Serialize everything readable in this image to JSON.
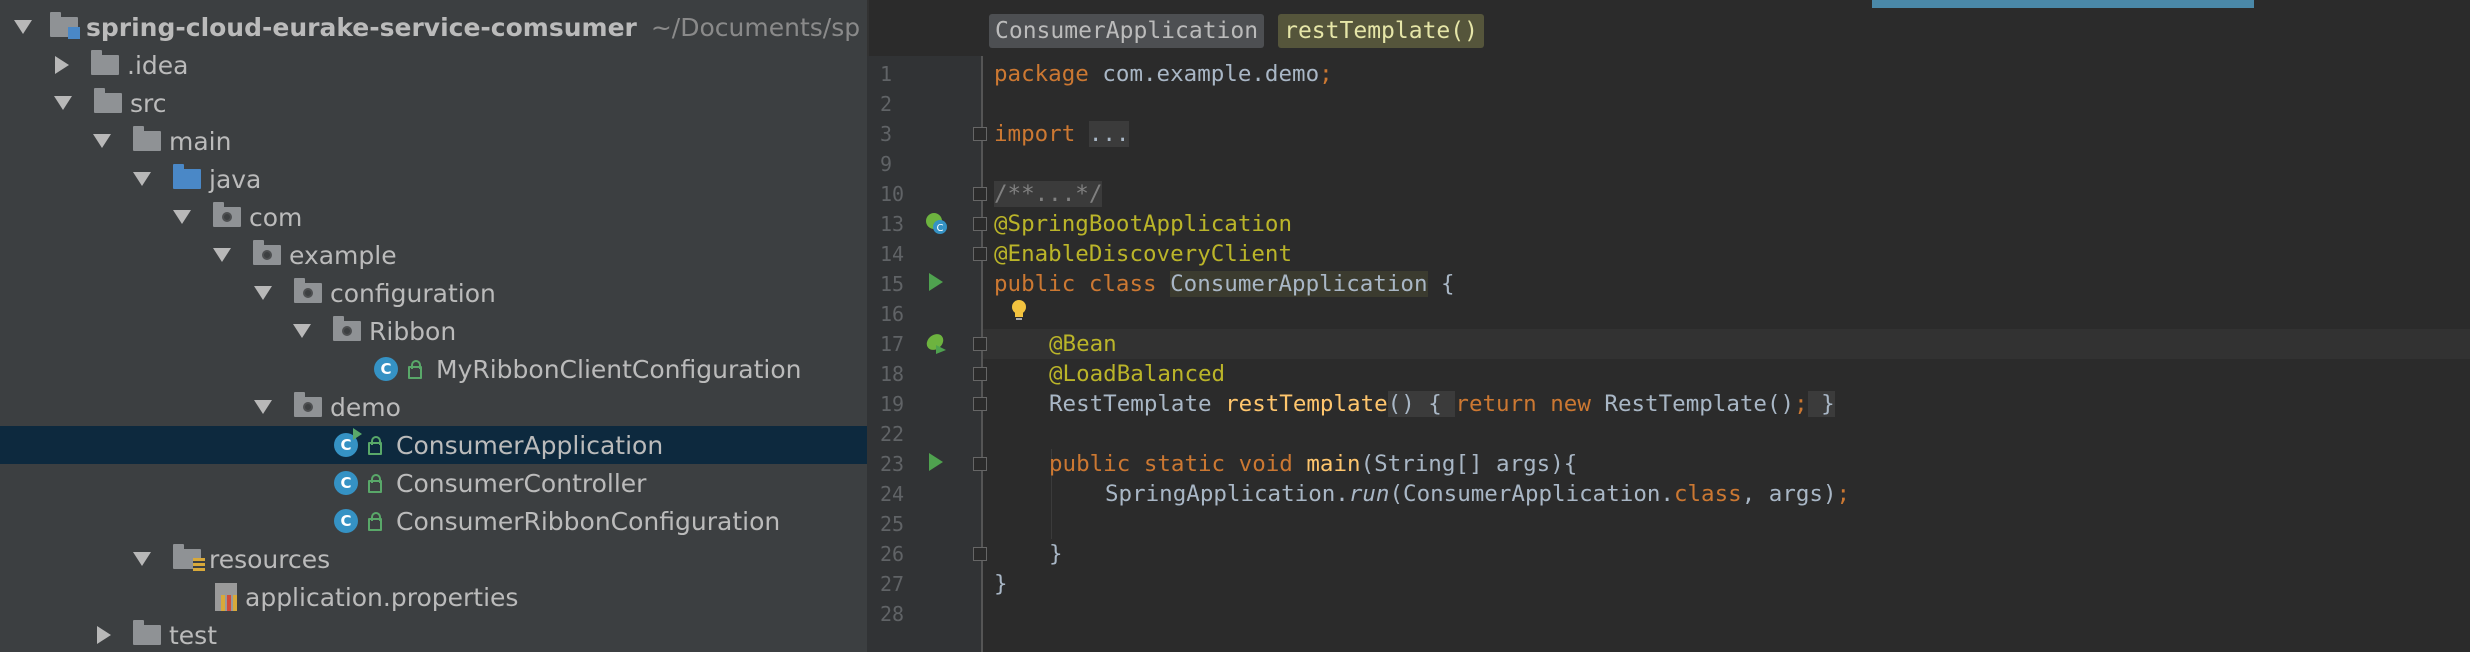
{
  "project_tree": {
    "root": {
      "name": "spring-cloud-eurake-service-comsumer",
      "path": "~/Documents/sp"
    },
    "items": [
      {
        "label": ".idea"
      },
      {
        "label": "src"
      },
      {
        "label": "main"
      },
      {
        "label": "java"
      },
      {
        "label": "com"
      },
      {
        "label": "example"
      },
      {
        "label": "configuration"
      },
      {
        "label": "Ribbon"
      },
      {
        "label": "MyRibbonClientConfiguration"
      },
      {
        "label": "demo"
      },
      {
        "label": "ConsumerApplication"
      },
      {
        "label": "ConsumerController"
      },
      {
        "label": "ConsumerRibbonConfiguration"
      },
      {
        "label": "resources"
      },
      {
        "label": "application.properties"
      },
      {
        "label": "test"
      }
    ]
  },
  "editor": {
    "breadcrumbs": {
      "class": "ConsumerApplication",
      "method": "restTemplate()"
    },
    "line_numbers": [
      "1",
      "2",
      "3",
      "9",
      "10",
      "13",
      "14",
      "15",
      "16",
      "17",
      "18",
      "19",
      "22",
      "23",
      "24",
      "25",
      "26",
      "27",
      "28"
    ],
    "code": {
      "l1_kw": "package",
      "l1_rest": " com.example.demo",
      "l1_semi": ";",
      "l3_kw": "import",
      "l3_fold": "...",
      "l10": "/**...*/",
      "l13": "@SpringBootApplication",
      "l14": "@EnableDiscoveryClient",
      "l15_kw": "public class ",
      "l15_name": "ConsumerApplication",
      "l15_rest": " {",
      "l17": "@Bean",
      "l18": "@LoadBalanced",
      "l19_type": "RestTemplate ",
      "l19_fn": "restTemplate",
      "l19_paren": "()",
      "l19_ob": " { ",
      "l19_kw1": "return ",
      "l19_kw2": "new ",
      "l19_ctor": "RestTemplate()",
      "l19_semi": ";",
      "l19_cb": " }",
      "l23_kw": "public static void ",
      "l23_fn": "main",
      "l23_rest": "(String[] args){",
      "l24_obj": "SpringApplication.",
      "l24_fn": "run",
      "l24_a": "(ConsumerApplication.",
      "l24_kw": "class",
      "l24_b": ", args)",
      "l24_semi": ";",
      "l26": "}",
      "l27": "}"
    }
  },
  "colors": {
    "keyword": "#cc7832",
    "annotation": "#bbb529",
    "method": "#ffc66d",
    "text": "#a9b7c6",
    "selection": "#0d293e",
    "class_icon": "#3592c4",
    "run_icon": "#4fa24f"
  },
  "icons": [
    "folder-icon",
    "class-icon",
    "lock-icon",
    "run-gutter-icon",
    "bean-gutter-icon",
    "lightbulb-icon",
    "fold-icon",
    "properties-file-icon"
  ]
}
